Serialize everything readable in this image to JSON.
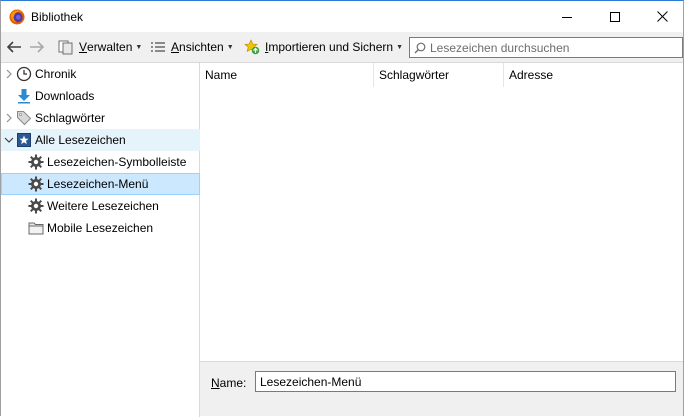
{
  "window": {
    "title": "Bibliothek",
    "minimize_icon": "minimize-icon",
    "maximize_icon": "maximize-icon",
    "close_icon": "close-icon"
  },
  "toolbar": {
    "back_icon": "arrow-left-icon",
    "forward_icon": "arrow-right-icon",
    "organize_underline": "V",
    "organize_rest": "erwalten",
    "views_underline": "A",
    "views_rest": "nsichten",
    "import_underline": "I",
    "import_rest": "mportieren und Sichern",
    "search_placeholder": "Lesezeichen durchsuchen"
  },
  "sidebar": {
    "items": [
      {
        "label": "Chronik",
        "icon": "clock-icon"
      },
      {
        "label": "Downloads",
        "icon": "download-arrow-icon"
      },
      {
        "label": "Schlagwörter",
        "icon": "tag-icon"
      },
      {
        "label": "Alle Lesezeichen",
        "icon": "bookmark-star-icon"
      },
      {
        "label": "Lesezeichen-Symbolleiste",
        "icon": "gear-icon"
      },
      {
        "label": "Lesezeichen-Menü",
        "icon": "gear-icon"
      },
      {
        "label": "Weitere Lesezeichen",
        "icon": "gear-icon"
      },
      {
        "label": "Mobile Lesezeichen",
        "icon": "folder-icon"
      }
    ],
    "selected": "Lesezeichen-Menü"
  },
  "columns": [
    "Name",
    "Schlagwörter",
    "Adresse"
  ],
  "details": {
    "name_underline": "N",
    "name_rest": "ame:",
    "name_value": "Lesezeichen-Menü"
  },
  "colors": {
    "selection_bg": "#cce8ff",
    "hover_bg": "#e5f3fb",
    "toolbar_bg": "#f0f0f0"
  }
}
